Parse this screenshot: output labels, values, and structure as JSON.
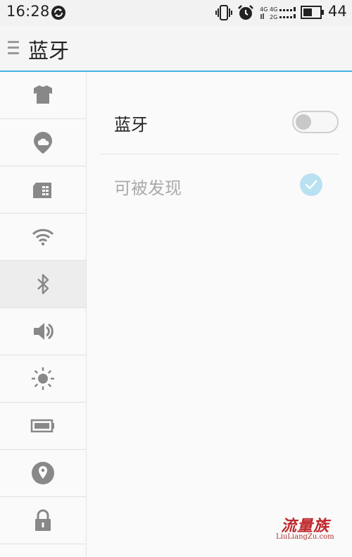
{
  "status_bar": {
    "time": "16:28",
    "battery_level": "44",
    "network_labels": [
      "4G",
      "4G",
      "2G"
    ],
    "icons": [
      "sync-icon",
      "vibrate-icon",
      "alarm-icon",
      "signal-icon",
      "battery-icon"
    ]
  },
  "header": {
    "title": "蓝牙",
    "menu_icon": "menu-icon",
    "accent_color": "#41b5de"
  },
  "sidebar": {
    "items": [
      {
        "name": "personalize",
        "icon": "tshirt-icon"
      },
      {
        "name": "account",
        "icon": "cloud-location-icon"
      },
      {
        "name": "sim",
        "icon": "sim-card-icon"
      },
      {
        "name": "wifi",
        "icon": "wifi-icon"
      },
      {
        "name": "bluetooth",
        "icon": "bluetooth-icon",
        "active": true
      },
      {
        "name": "sound",
        "icon": "speaker-icon"
      },
      {
        "name": "display",
        "icon": "brightness-icon"
      },
      {
        "name": "battery",
        "icon": "battery-icon"
      },
      {
        "name": "location",
        "icon": "location-pin-icon"
      },
      {
        "name": "security",
        "icon": "lock-icon"
      }
    ]
  },
  "settings": {
    "bluetooth_label": "蓝牙",
    "bluetooth_on": false,
    "discoverable_label": "可被发现",
    "discoverable_checked": true,
    "discoverable_enabled": false
  },
  "watermark": {
    "logo_text": "流量族",
    "url": "LiuLiangZu.com"
  }
}
